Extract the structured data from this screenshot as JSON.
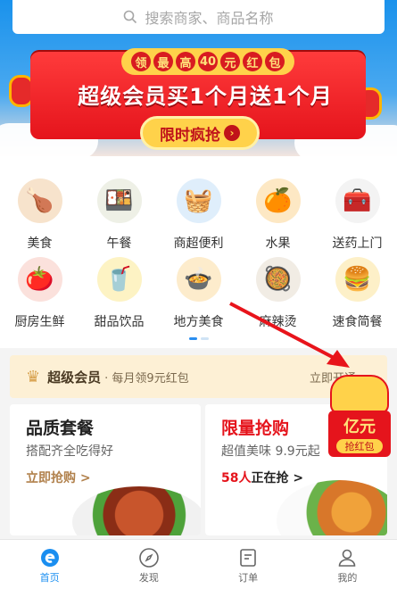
{
  "search": {
    "placeholder": "搜索商家、商品名称"
  },
  "banner": {
    "pill_chars": [
      "领",
      "最",
      "高",
      "40",
      "元",
      "红",
      "包"
    ],
    "headline": "超级会员买1个月送1个月",
    "cta": "限时疯抢"
  },
  "categories": [
    {
      "label": "美食",
      "icon": "roast-chicken-icon"
    },
    {
      "label": "午餐",
      "icon": "lunch-bowl-icon"
    },
    {
      "label": "商超便利",
      "icon": "supermarket-basket-icon"
    },
    {
      "label": "水果",
      "icon": "orange-icon"
    },
    {
      "label": "送药上门",
      "icon": "medicine-box-icon"
    },
    {
      "label": "厨房生鲜",
      "icon": "vegetables-icon"
    },
    {
      "label": "甜品饮品",
      "icon": "drink-cup-icon"
    },
    {
      "label": "地方美食",
      "icon": "local-dish-icon"
    },
    {
      "label": "麻辣烫",
      "icon": "spicy-hotpot-icon"
    },
    {
      "label": "速食简餐",
      "icon": "fast-food-icon"
    }
  ],
  "member": {
    "title": "超级会员",
    "subtitle": "· 每月领9元红包",
    "action": "立即开通 >"
  },
  "cards": [
    {
      "title": "品质套餐",
      "subtitle": "搭配齐全吃得好",
      "action": "立即抢购 >"
    },
    {
      "title": "限量抢购",
      "subtitle": "超值美味 9.9元起",
      "count": "58人",
      "action": "正在抢 >"
    }
  ],
  "red_packet": {
    "big": "亿元",
    "small": "抢红包"
  },
  "nav": [
    {
      "label": "首页",
      "icon": "home-e-icon",
      "active": true
    },
    {
      "label": "发现",
      "icon": "compass-icon",
      "active": false
    },
    {
      "label": "订单",
      "icon": "order-list-icon",
      "active": false
    },
    {
      "label": "我的",
      "icon": "user-icon",
      "active": false
    }
  ],
  "colors": {
    "brand_blue": "#1a8ef0",
    "accent_red": "#e5141c",
    "gold": "#ffd24a"
  }
}
